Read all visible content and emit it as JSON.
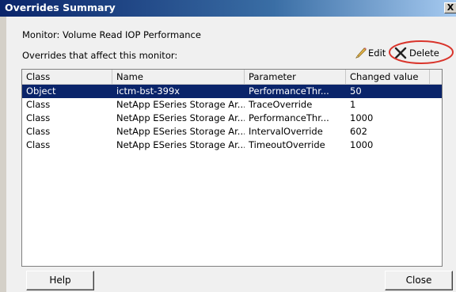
{
  "window": {
    "title": "Overrides Summary",
    "close_glyph": "X"
  },
  "monitor_label": "Monitor: Volume Read IOP Performance",
  "overrides_label": "Overrides that affect this monitor:",
  "toolbar": {
    "edit_label": "Edit",
    "delete_label": "Delete",
    "edit_icon": "pencil-icon",
    "delete_icon": "x-icon",
    "highlight_color": "#d9342b"
  },
  "table": {
    "columns": [
      "Class",
      "Name",
      "Parameter",
      "Changed value"
    ],
    "rows": [
      [
        "Object",
        "ictm-bst-399x",
        "PerformanceThr...",
        "50"
      ],
      [
        "Class",
        "NetApp ESeries Storage Ar...",
        "TraceOverride",
        "1"
      ],
      [
        "Class",
        "NetApp ESeries Storage Ar...",
        "PerformanceThr...",
        "1000"
      ],
      [
        "Class",
        "NetApp ESeries Storage Ar...",
        "IntervalOverride",
        "602"
      ],
      [
        "Class",
        "NetApp ESeries Storage Ar...",
        "TimeoutOverride",
        "1000"
      ]
    ],
    "selected_index": 0,
    "selected_color": "#0a246a"
  },
  "footer": {
    "help_label": "Help",
    "close_label": "Close"
  }
}
